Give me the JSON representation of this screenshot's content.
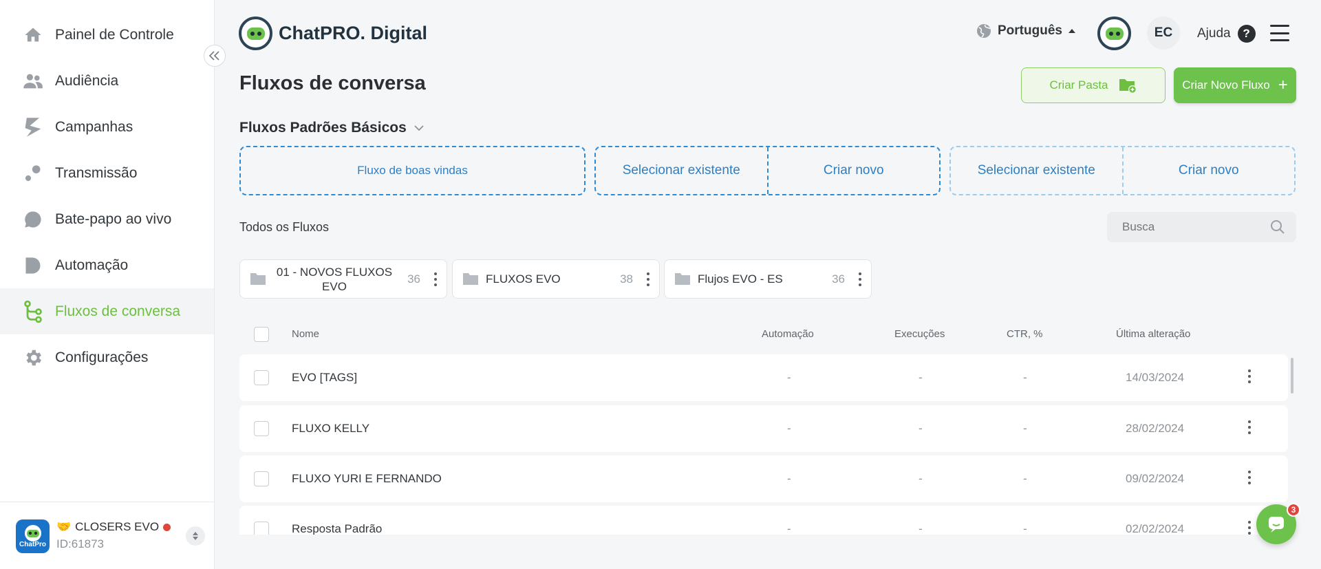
{
  "sidebar": {
    "items": [
      {
        "label": "Painel de Controle",
        "icon": "home-icon"
      },
      {
        "label": "Audiência",
        "icon": "people-icon"
      },
      {
        "label": "Campanhas",
        "icon": "campaign-icon"
      },
      {
        "label": "Transmissão",
        "icon": "broadcast-icon"
      },
      {
        "label": "Bate-papo ao vivo",
        "icon": "chat-icon"
      },
      {
        "label": "Automação",
        "icon": "automation-icon"
      },
      {
        "label": "Fluxos de conversa",
        "icon": "flow-icon"
      },
      {
        "label": "Configurações",
        "icon": "gear-icon"
      }
    ],
    "active_index": 6,
    "account": {
      "emoji": "🤝",
      "name": "CLOSERS EVO",
      "id": "ID:61873",
      "avatar_text": "ChatPro"
    }
  },
  "header": {
    "brand": "ChatPRO. Digital",
    "language": "Português",
    "user_initials": "EC",
    "help_label": "Ajuda",
    "help_glyph": "?"
  },
  "page": {
    "title": "Fluxos de conversa",
    "create_folder_label": "Criar Pasta",
    "create_flow_label": "Criar Novo Fluxo",
    "create_flow_glyph": "+"
  },
  "basic_flows": {
    "title": "Fluxos Padrões Básicos",
    "welcome_label": "Fluxo de boas vindas",
    "select_existing_label": "Selecionar existente",
    "create_new_label": "Criar novo"
  },
  "all_flows": {
    "title": "Todos os Fluxos",
    "search_placeholder": "Busca"
  },
  "folders": [
    {
      "name": "01 - NOVOS FLUXOS EVO",
      "count": "36"
    },
    {
      "name": "FLUXOS EVO",
      "count": "38"
    },
    {
      "name": "Flujos EVO - ES",
      "count": "36"
    }
  ],
  "table": {
    "columns": {
      "name": "Nome",
      "automation": "Automação",
      "executions": "Execuções",
      "ctr": "CTR, %",
      "updated": "Última alteração"
    },
    "rows": [
      {
        "name": "EVO [TAGS]",
        "automation": "-",
        "executions": "-",
        "ctr": "-",
        "updated": "14/03/2024"
      },
      {
        "name": "FLUXO KELLY",
        "automation": "-",
        "executions": "-",
        "ctr": "-",
        "updated": "28/02/2024"
      },
      {
        "name": "FLUXO YURI E FERNANDO",
        "automation": "-",
        "executions": "-",
        "ctr": "-",
        "updated": "09/02/2024"
      },
      {
        "name": "Resposta Padrão",
        "automation": "-",
        "executions": "-",
        "ctr": "-",
        "updated": "02/02/2024"
      }
    ]
  },
  "chat_widget": {
    "badge": "3"
  },
  "colors": {
    "accent": "#6cc24a",
    "link": "#2d7fc4",
    "alert": "#e2453c"
  }
}
